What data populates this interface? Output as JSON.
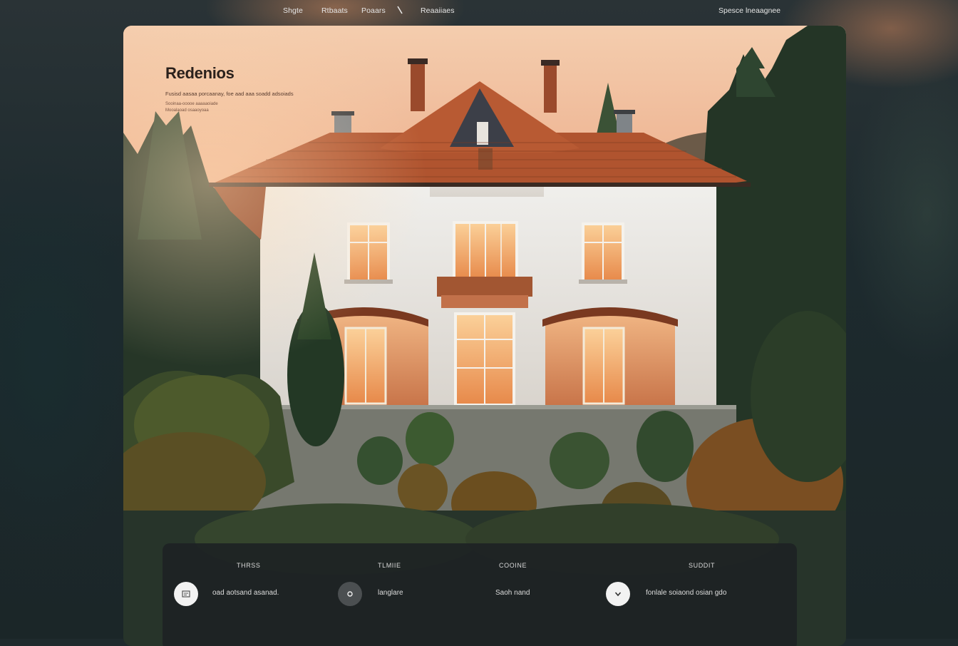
{
  "nav": {
    "items": [
      "Shgte",
      "Rtbaats",
      "Poaars"
    ],
    "highlight": "Reaaiiaes",
    "right": "Spesce lneaagnee"
  },
  "hero": {
    "title": "Redenios",
    "description": "Fusisd aasaa porcaanay, foe aad aaa soadd adsoiads",
    "sub_lines": [
      "Sooinaa-ooooe aaaaaoiade",
      "Mooalaoad osaaoyoaa"
    ]
  },
  "features": [
    {
      "heading": "THRSS",
      "icon": "document-icon",
      "text": "oad aotsand asanad."
    },
    {
      "heading": "TLMIIE",
      "icon": "circle-dot-icon",
      "text": "langlare"
    },
    {
      "heading": "COOINE",
      "icon": "",
      "text": "Saoh nand"
    },
    {
      "heading": "SUDDIT",
      "icon": "chevron-down-icon",
      "text": "fonlale soiaond osian gdo"
    }
  ],
  "colors": {
    "roof": "#b0542f",
    "wall": "#ecebe6",
    "window_glow": "#f0a861",
    "panel": "#1e2224"
  }
}
